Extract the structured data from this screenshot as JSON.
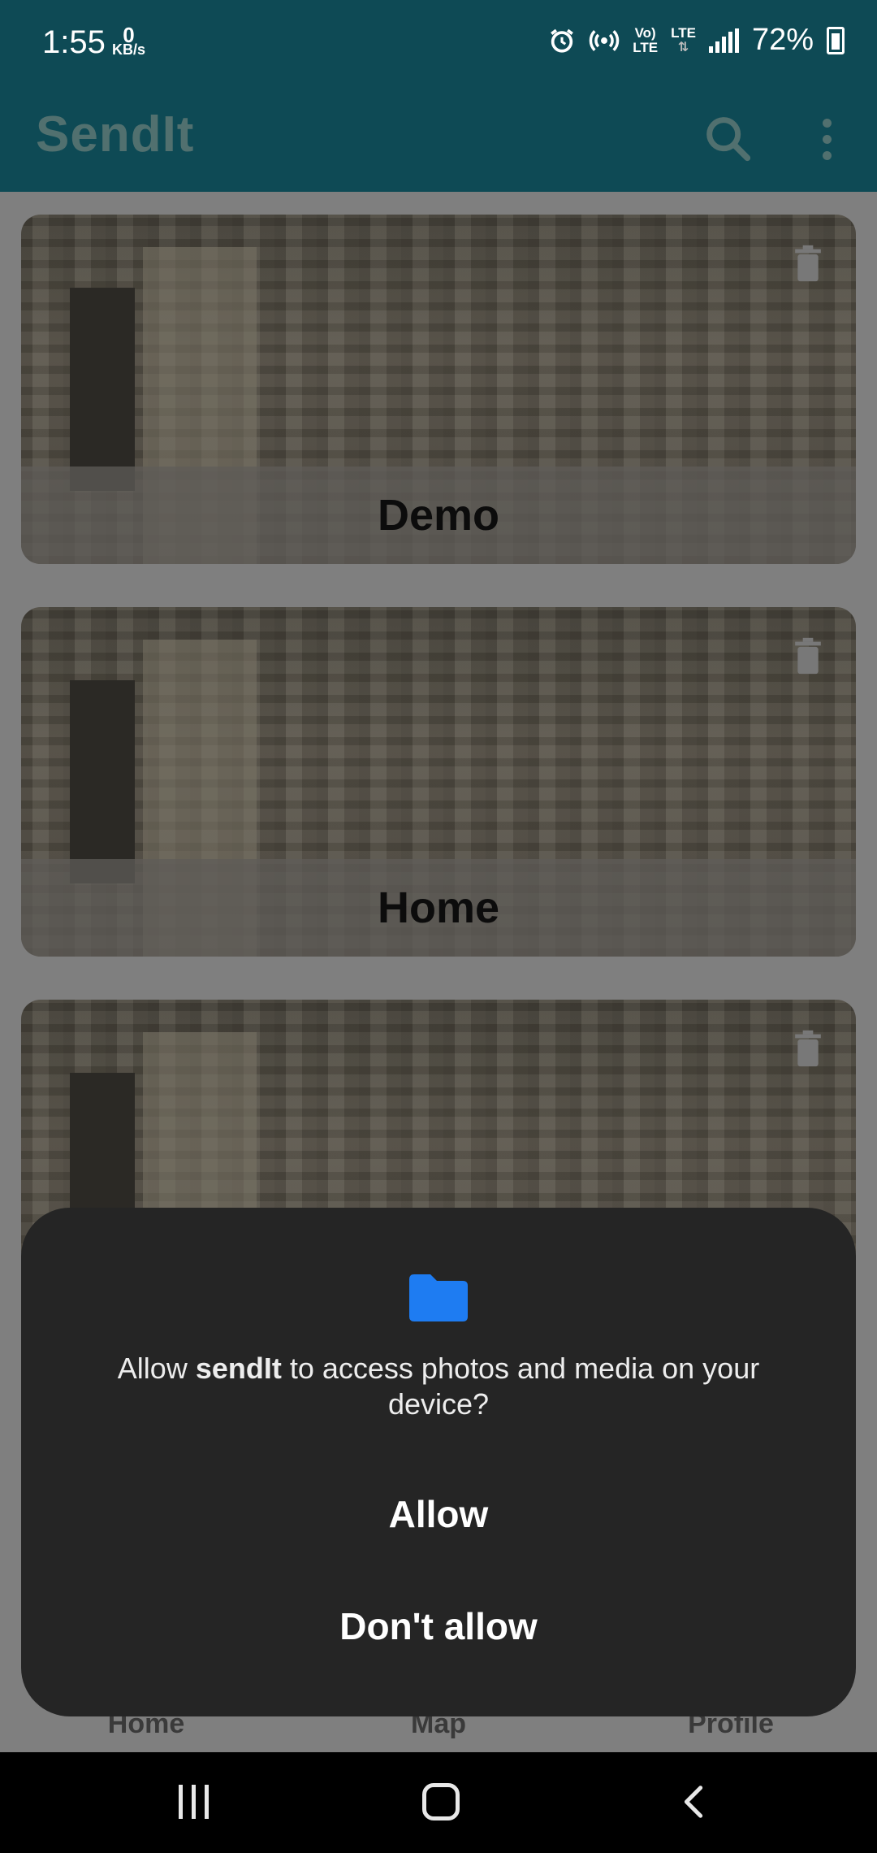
{
  "status_bar": {
    "time": "1:55",
    "net_speed_value": "0",
    "net_speed_unit": "KB/s",
    "volte_top": "Vo)",
    "volte_bottom": "LTE",
    "lte_label": "LTE",
    "battery_percent": "72%",
    "icons": [
      "alarm-icon",
      "hotspot-icon",
      "signal-icon",
      "battery-charging-icon"
    ]
  },
  "app_bar": {
    "title": "SendIt",
    "icons": [
      "search-icon",
      "more-vert-icon"
    ]
  },
  "locations": [
    {
      "name": "Demo"
    },
    {
      "name": "Home"
    },
    {
      "name": ""
    }
  ],
  "bottom_nav": {
    "items": [
      {
        "label": "Home"
      },
      {
        "label": "Map"
      },
      {
        "label": "Profile"
      }
    ]
  },
  "permission_dialog": {
    "icon": "folder-icon",
    "message_prefix": "Allow ",
    "app_name": "sendIt",
    "message_suffix": " to access photos and media on your device?",
    "allow_label": "Allow",
    "deny_label": "Don't allow"
  },
  "system_nav": {
    "icons": [
      "recents-icon",
      "home-icon",
      "back-icon"
    ]
  },
  "colors": {
    "app_bar": "#0e4a55",
    "dialog_bg": "#252525",
    "folder_accent": "#1e7cf2"
  }
}
